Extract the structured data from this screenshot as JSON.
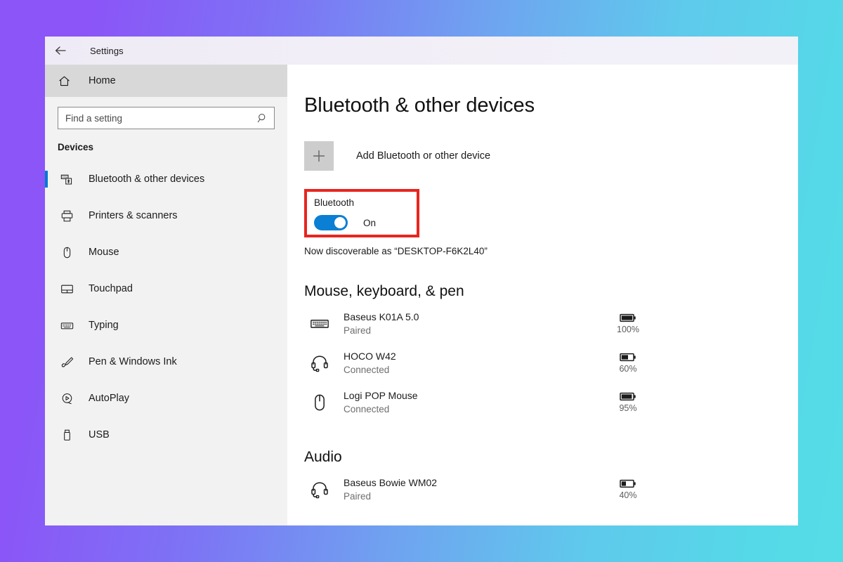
{
  "titlebar": {
    "back_icon": "back-arrow-icon",
    "title": "Settings"
  },
  "sidebar": {
    "home": {
      "label": "Home",
      "icon": "home-icon"
    },
    "search": {
      "placeholder": "Find a setting",
      "value": "",
      "icon": "search-icon"
    },
    "group_heading": "Devices",
    "items": [
      {
        "label": "Bluetooth & other devices",
        "icon": "bluetooth-devices-icon",
        "selected": true
      },
      {
        "label": "Printers & scanners",
        "icon": "printer-icon",
        "selected": false
      },
      {
        "label": "Mouse",
        "icon": "mouse-icon",
        "selected": false
      },
      {
        "label": "Touchpad",
        "icon": "touchpad-icon",
        "selected": false
      },
      {
        "label": "Typing",
        "icon": "keyboard-icon",
        "selected": false
      },
      {
        "label": "Pen & Windows Ink",
        "icon": "pen-icon",
        "selected": false
      },
      {
        "label": "AutoPlay",
        "icon": "autoplay-icon",
        "selected": false
      },
      {
        "label": "USB",
        "icon": "usb-icon",
        "selected": false
      }
    ]
  },
  "main": {
    "page_title": "Bluetooth & other devices",
    "add_device": {
      "label": "Add Bluetooth or other device",
      "icon": "plus-icon"
    },
    "bluetooth": {
      "label": "Bluetooth",
      "state": "On",
      "toggle_on": true,
      "highlighted": true,
      "highlight_color": "#e8251f",
      "accent_color": "#0a7fd4"
    },
    "discoverable": "Now discoverable as “DESKTOP-F6K2L40”",
    "sections": [
      {
        "heading": "Mouse, keyboard, & pen",
        "devices": [
          {
            "name": "Baseus K01A 5.0",
            "status": "Paired",
            "battery": "100%",
            "battery_level": 100,
            "icon": "keyboard-icon"
          },
          {
            "name": "HOCO W42",
            "status": "Connected",
            "battery": "60%",
            "battery_level": 60,
            "icon": "headset-icon"
          },
          {
            "name": "Logi POP Mouse",
            "status": "Connected",
            "battery": "95%",
            "battery_level": 95,
            "icon": "mouse-icon"
          }
        ]
      },
      {
        "heading": "Audio",
        "devices": [
          {
            "name": "Baseus Bowie WM02",
            "status": "Paired",
            "battery": "40%",
            "battery_level": 40,
            "icon": "headset-icon"
          }
        ]
      }
    ]
  },
  "background": {
    "gradient_start": "#8b55f7",
    "gradient_end": "#55d8e8"
  }
}
